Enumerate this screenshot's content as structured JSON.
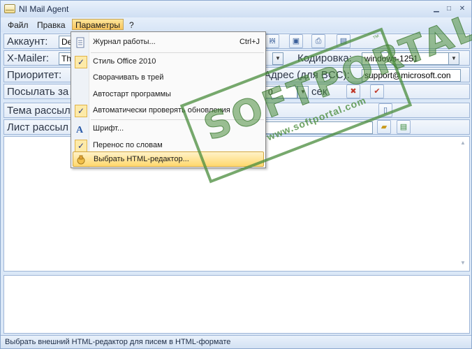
{
  "window": {
    "title": "NI Mail Agent"
  },
  "menubar": [
    "Файл",
    "Правка",
    "Параметры",
    "?"
  ],
  "form": {
    "account_label": "Аккаунт:",
    "account_value": "De",
    "xmailer_label": "X-Mailer:",
    "xmailer_value": "Th",
    "encoding_label": "Кодировка:",
    "encoding_value": "windows-1251",
    "priority_label": "Приоритет:",
    "bcc_label": "Адрес (для BCC):",
    "bcc_value": "support@microsoft.con",
    "send_label": "Посылать за",
    "send_value": "0",
    "send_suffix": "сек",
    "subject_label": "Тема рассыл",
    "list_label": "Лист рассыл"
  },
  "dropdown": {
    "items": [
      {
        "label": "Журнал работы...",
        "shortcut": "Ctrl+J",
        "icon": "journal-icon"
      },
      {
        "label": "Стиль Office 2010",
        "checked": true
      },
      {
        "label": "Сворачивать в трей"
      },
      {
        "label": "Автостарт программы"
      },
      {
        "label": "Автоматически проверять обновления",
        "checked": true
      },
      {
        "label": "Шрифт...",
        "icon": "font-icon"
      },
      {
        "label": "Перенос по словам",
        "checked": true
      },
      {
        "label": "Выбрать HTML-редактор...",
        "icon": "html-editor-icon",
        "highlighted": true
      }
    ]
  },
  "status": {
    "text": "Выбрать внешний HTML-редактор для писем в HTML-формате"
  },
  "watermark": {
    "brand": "SOFTPORTAL",
    "site": "www.softportal.com",
    "tm": "™"
  },
  "colors": {
    "menu_highlight": "#f8c55c",
    "watermark": "#4a8c3c",
    "frame": "#9fb6d7"
  }
}
